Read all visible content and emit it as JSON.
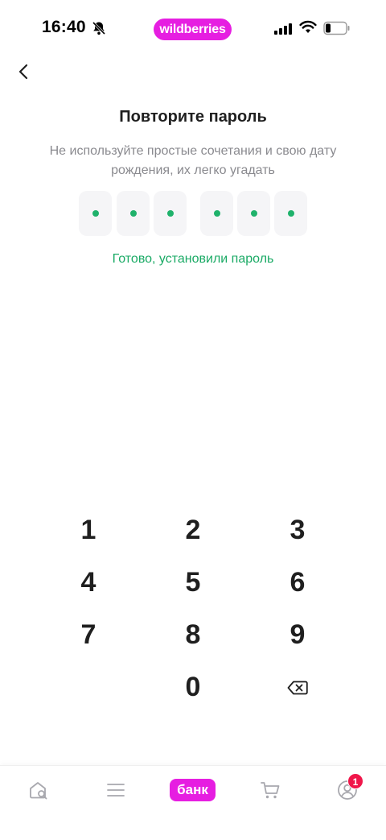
{
  "status_bar": {
    "time": "16:40",
    "brand": "wildberries",
    "icons": [
      "bell-slash-icon",
      "cellular-signal-icon",
      "wifi-icon",
      "battery-icon"
    ]
  },
  "header": {
    "back_icon": "chevron-left-icon",
    "title": "Повторите пароль",
    "subtitle": "Не используйте простые сочетания и свою дату рождения, их легко угадать"
  },
  "pin": {
    "length": 6,
    "filled": 6,
    "success_message": "Готово, установили пароль"
  },
  "keypad": {
    "keys": [
      "1",
      "2",
      "3",
      "4",
      "5",
      "6",
      "7",
      "8",
      "9",
      "0"
    ],
    "delete_icon": "backspace-icon"
  },
  "bottom_nav": {
    "items": [
      {
        "icon": "home-search-icon"
      },
      {
        "icon": "menu-icon"
      },
      {
        "label": "банк"
      },
      {
        "icon": "cart-icon"
      },
      {
        "icon": "profile-icon",
        "badge": "1"
      }
    ]
  },
  "colors": {
    "brand": "#e61ee1",
    "success": "#1aaa65",
    "pin_dot": "#1fb26b",
    "badge": "#f0164a"
  }
}
